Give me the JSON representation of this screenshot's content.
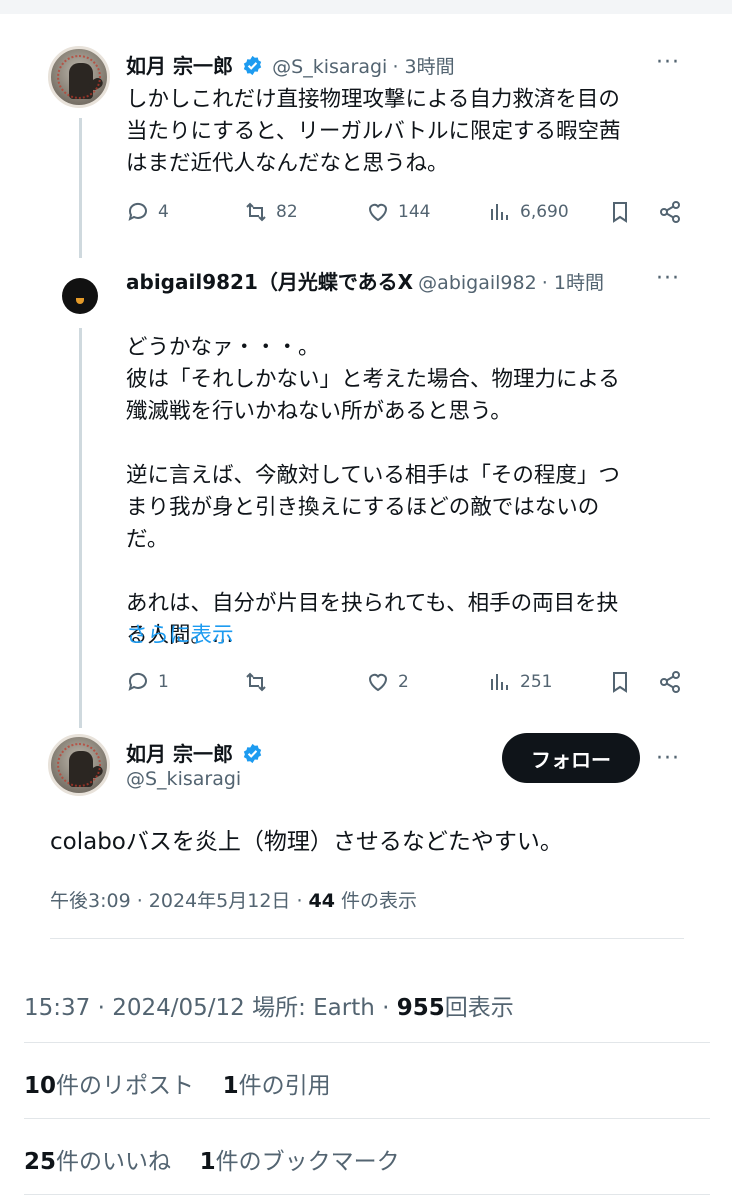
{
  "tweet1": {
    "name": "如月 宗一郎",
    "handle": "@S_kisaragi",
    "time": "· 3時間",
    "lines": [
      "しかしこれだけ直接物理攻撃による自力救済を目の",
      "当たりにすると、リーガルバトルに限定する暇空茜",
      "はまだ近代人なんだなと思うね。"
    ],
    "replies": "4",
    "retweets": "82",
    "likes": "144",
    "views": "6,690"
  },
  "tweet2": {
    "name": "abigail9821（月光蝶であるX",
    "handle": "@abigail982",
    "time": "· 1時間",
    "lines": [
      "どうかなァ・・・。",
      "彼は「それしかない」と考えた場合、物理力による",
      "殲滅戦を行いかねない所があると思う。",
      "",
      "逆に言えば、今敵対している相手は「その程度」つ",
      "まり我が身と引き換えにするほどの敵ではないの",
      "だ。",
      "",
      "あれは、自分が片目を抉られても、相手の両目を抉",
      "る人間。…"
    ],
    "show_more": "さらに表示",
    "replies": "1",
    "likes": "2",
    "views": "251"
  },
  "tweet3": {
    "name": "如月 宗一郎",
    "handle": "@S_kisaragi",
    "follow_label": "フォロー",
    "text": "colaboバスを炎上（物理）させるなどたやすい。",
    "meta_prefix": "午後3:09 · 2024年5月12日 · ",
    "meta_count": "44",
    "meta_suffix": " 件の表示"
  },
  "outer": {
    "meta_prefix": "15:37 · 2024/05/12 場所: Earth · ",
    "views_count": "955",
    "views_suffix": "回表示",
    "reposts_count": "10",
    "reposts_label": "件のリポスト",
    "quotes_count": "1",
    "quotes_label": "件の引用",
    "likes_count": "25",
    "likes_label": "件のいいね",
    "bookmarks_count": "1",
    "bookmarks_label": "件のブックマーク"
  },
  "colors": {
    "accent": "#1d9bf0",
    "text": "#0f1419",
    "muted": "#536471"
  }
}
